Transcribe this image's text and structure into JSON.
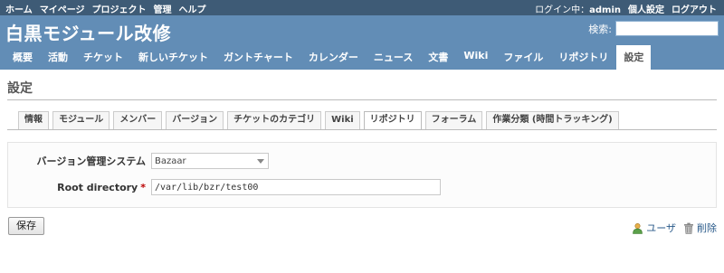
{
  "top_menu": {
    "items": [
      "ホーム",
      "マイページ",
      "プロジェクト",
      "管理",
      "ヘルプ"
    ],
    "logged_as_prefix": "ログイン中：",
    "user": "admin",
    "my_account": "個人設定",
    "logout": "ログアウト"
  },
  "header": {
    "project_title": "白黒モジュール改修",
    "search_label": "検索:",
    "search_value": ""
  },
  "main_menu": {
    "tabs": [
      {
        "label": "概要"
      },
      {
        "label": "活動"
      },
      {
        "label": "チケット"
      },
      {
        "label": "新しいチケット"
      },
      {
        "label": "ガントチャート"
      },
      {
        "label": "カレンダー"
      },
      {
        "label": "ニュース"
      },
      {
        "label": "文書"
      },
      {
        "label": "Wiki"
      },
      {
        "label": "ファイル"
      },
      {
        "label": "リポジトリ"
      },
      {
        "label": "設定",
        "selected": true
      }
    ]
  },
  "page": {
    "title": "設定"
  },
  "settings_tabs": [
    {
      "label": "情報"
    },
    {
      "label": "モジュール"
    },
    {
      "label": "メンバー"
    },
    {
      "label": "バージョン"
    },
    {
      "label": "チケットのカテゴリ"
    },
    {
      "label": "Wiki"
    },
    {
      "label": "リポジトリ",
      "selected": true
    },
    {
      "label": "フォーラム"
    },
    {
      "label": "作業分類 (時間トラッキング)"
    }
  ],
  "form": {
    "scm_label": "バージョン管理システム",
    "scm_value": "Bazaar",
    "root_label": "Root directory",
    "root_required_mark": "*",
    "root_value": "/var/lib/bzr/test00"
  },
  "buttons": {
    "save": "保存"
  },
  "actions": {
    "users": "ユーザ",
    "delete": "削除"
  },
  "colors": {
    "top_menu_bg": "#3e5b76",
    "header_bg": "#628db6",
    "required": "#bb0000",
    "link": "#2a5a8a"
  }
}
